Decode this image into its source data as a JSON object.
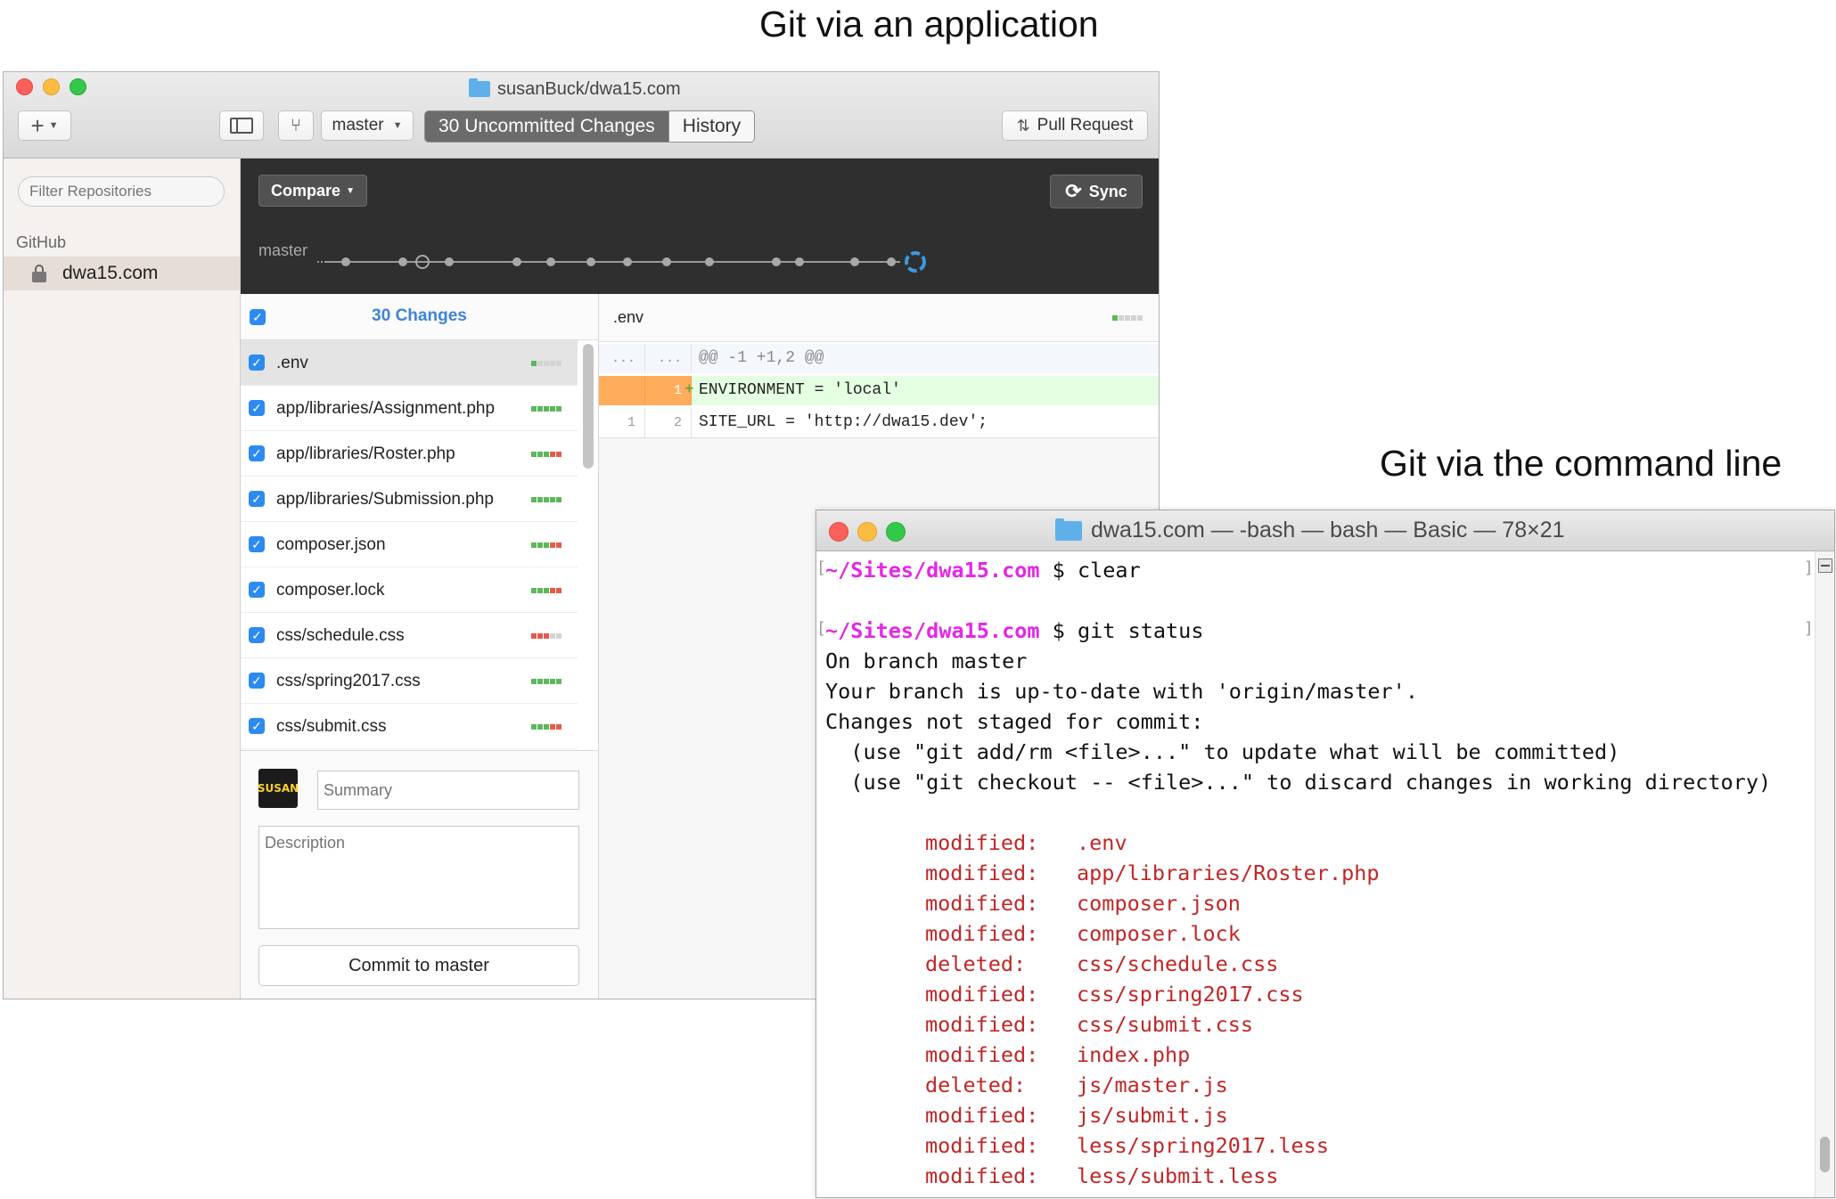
{
  "captions": {
    "app": "Git via an application",
    "cli": "Git via the command line"
  },
  "github_app": {
    "window_title": "susanBuck/dwa15.com",
    "toolbar": {
      "add_label": "+",
      "branch": "master",
      "tabs": [
        "30 Uncommitted Changes",
        "History"
      ],
      "active_tab": "30 Uncommitted Changes",
      "pull_request_label": "Pull Request"
    },
    "sidebar": {
      "filter_placeholder": "Filter Repositories",
      "section": "GitHub",
      "repos": [
        "dwa15.com"
      ]
    },
    "branch_panel": {
      "compare_label": "Compare",
      "sync_label": "Sync",
      "branch_label": "master"
    },
    "changes": {
      "title": "30 Changes",
      "files": [
        {
          "name": ".env",
          "stat": "1 add 4 none",
          "selected": true
        },
        {
          "name": "app/libraries/Assignment.php",
          "stat": "5 add"
        },
        {
          "name": "app/libraries/Roster.php",
          "stat": "3 add 2 del"
        },
        {
          "name": "app/libraries/Submission.php",
          "stat": "5 add"
        },
        {
          "name": "composer.json",
          "stat": "3 add 2 del"
        },
        {
          "name": "composer.lock",
          "stat": "3 add 2 del"
        },
        {
          "name": "css/schedule.css",
          "stat": "3 del 2 none"
        },
        {
          "name": "css/spring2017.css",
          "stat": "5 add"
        },
        {
          "name": "css/submit.css",
          "stat": "3 add 2 del"
        }
      ],
      "summary_placeholder": "Summary",
      "description_placeholder": "Description",
      "commit_label": "Commit to master",
      "avatar_text": "SUSAN"
    },
    "diff": {
      "filename": ".env",
      "hunk": "@@ -1 +1,2 @@",
      "rows": [
        {
          "old": "...",
          "new": "...",
          "prefix": "",
          "code": "@@ -1 +1,2 @@",
          "type": "hunk"
        },
        {
          "old": "",
          "new": "1",
          "prefix": "+",
          "code": "ENVIRONMENT = 'local'",
          "type": "added"
        },
        {
          "old": "1",
          "new": "2",
          "prefix": "",
          "code": "SITE_URL = 'http://dwa15.dev';",
          "type": "context"
        }
      ]
    },
    "colors": {
      "accent": "#2c8af1",
      "added": "#5bb85b",
      "deleted": "#e45b4b",
      "highlight": "#ffad5c"
    }
  },
  "terminal": {
    "window_title": "dwa15.com — -bash — bash — Basic — 78×21",
    "prompt_path": "~/Sites/dwa15.com",
    "commands": [
      "clear",
      "git status"
    ],
    "output": [
      "On branch master",
      "Your branch is up-to-date with 'origin/master'.",
      "Changes not staged for commit:",
      "  (use \"git add/rm <file>...\" to update what will be committed)",
      "  (use \"git checkout -- <file>...\" to discard changes in working directory)"
    ],
    "changes": [
      {
        "status": "modified:",
        "file": ".env"
      },
      {
        "status": "modified:",
        "file": "app/libraries/Roster.php"
      },
      {
        "status": "modified:",
        "file": "composer.json"
      },
      {
        "status": "modified:",
        "file": "composer.lock"
      },
      {
        "status": "deleted:",
        "file": "css/schedule.css"
      },
      {
        "status": "modified:",
        "file": "css/spring2017.css"
      },
      {
        "status": "modified:",
        "file": "css/submit.css"
      },
      {
        "status": "modified:",
        "file": "index.php"
      },
      {
        "status": "deleted:",
        "file": "js/master.js"
      },
      {
        "status": "modified:",
        "file": "js/submit.js"
      },
      {
        "status": "modified:",
        "file": "less/spring2017.less"
      },
      {
        "status": "modified:",
        "file": "less/submit.less"
      }
    ]
  }
}
